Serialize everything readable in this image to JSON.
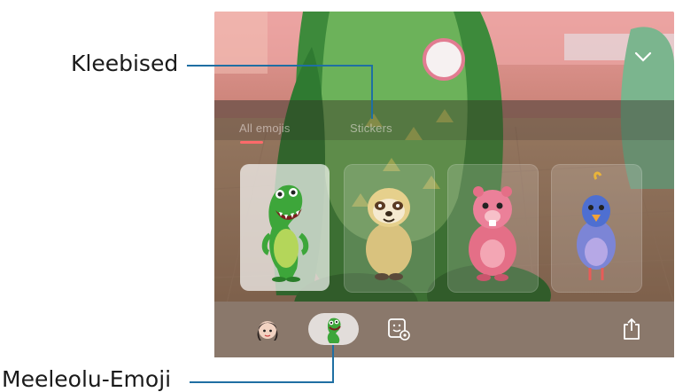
{
  "callouts": {
    "stickers_label": "Kleebised",
    "mood_emoji_label": "Meeleolu-Emoji"
  },
  "screen": {
    "tabs": [
      {
        "label": "All emojis",
        "selected": true
      },
      {
        "label": "Stickers",
        "selected": false
      }
    ],
    "emoji_cards": [
      {
        "name": "green-dinosaur",
        "selected": true
      },
      {
        "name": "sloth",
        "selected": false
      },
      {
        "name": "pink-beaver",
        "selected": false
      },
      {
        "name": "blue-bird",
        "selected": false
      }
    ],
    "bottom_bar": {
      "items": [
        "my-emoji-avatar-icon",
        "mood-emoji-dino-icon",
        "sticker-settings-icon",
        "share-icon"
      ]
    },
    "accent_color": "#ff6a6a"
  }
}
